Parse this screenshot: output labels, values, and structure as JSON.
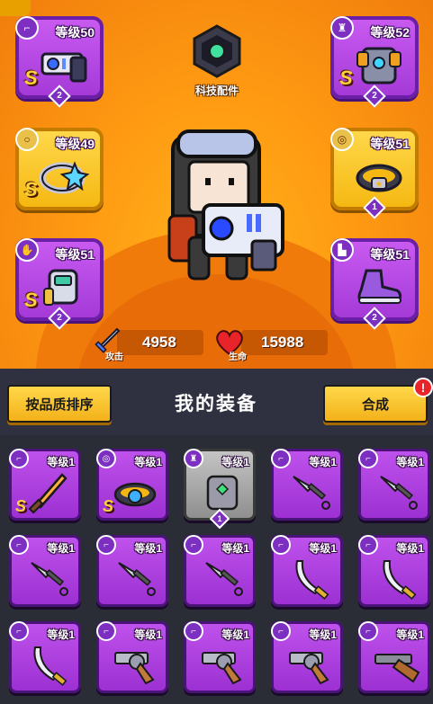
{
  "equipped": {
    "weapon": {
      "level": "等级50",
      "grade": "S",
      "stars": "2"
    },
    "armor": {
      "level": "等级52",
      "grade": "S",
      "stars": "2"
    },
    "ring": {
      "level": "等级49",
      "grade": "S"
    },
    "belt": {
      "level": "等级51",
      "stars": "1"
    },
    "glove": {
      "level": "等级51",
      "grade": "S",
      "stars": "2"
    },
    "boots": {
      "level": "等级51",
      "stars": "2"
    }
  },
  "tech_parts": {
    "label": "科技配件"
  },
  "stats": {
    "attack_label": "攻击",
    "attack_value": "4958",
    "hp_label": "生命",
    "hp_value": "15988"
  },
  "toolbar": {
    "sort_label": "按品质排序",
    "title": "我的装备",
    "merge_label": "合成",
    "alert_mark": "!"
  },
  "inventory": [
    {
      "level": "等级1",
      "item": "sword",
      "grade": "S"
    },
    {
      "level": "等级1",
      "item": "belt",
      "grade": "S"
    },
    {
      "level": "等级1",
      "item": "armor",
      "stars": "1"
    },
    {
      "level": "等级1",
      "item": "kunai"
    },
    {
      "level": "等级1",
      "item": "kunai"
    },
    {
      "level": "等级1",
      "item": "kunai"
    },
    {
      "level": "等级1",
      "item": "kunai"
    },
    {
      "level": "等级1",
      "item": "kunai"
    },
    {
      "level": "等级1",
      "item": "katana"
    },
    {
      "level": "等级1",
      "item": "katana"
    },
    {
      "level": "等级1",
      "item": "katana"
    },
    {
      "level": "等级1",
      "item": "revolver"
    },
    {
      "level": "等级1",
      "item": "revolver"
    },
    {
      "level": "等级1",
      "item": "revolver"
    },
    {
      "level": "等级1",
      "item": "shotgun"
    }
  ],
  "colors": {
    "hero_bg": "#ff9a12",
    "slot_purple": "#b247e2",
    "slot_gold": "#f5b812",
    "button_yellow": "#f3b11a",
    "alert_red": "#e8242a",
    "panel_dark": "#2f3140"
  }
}
